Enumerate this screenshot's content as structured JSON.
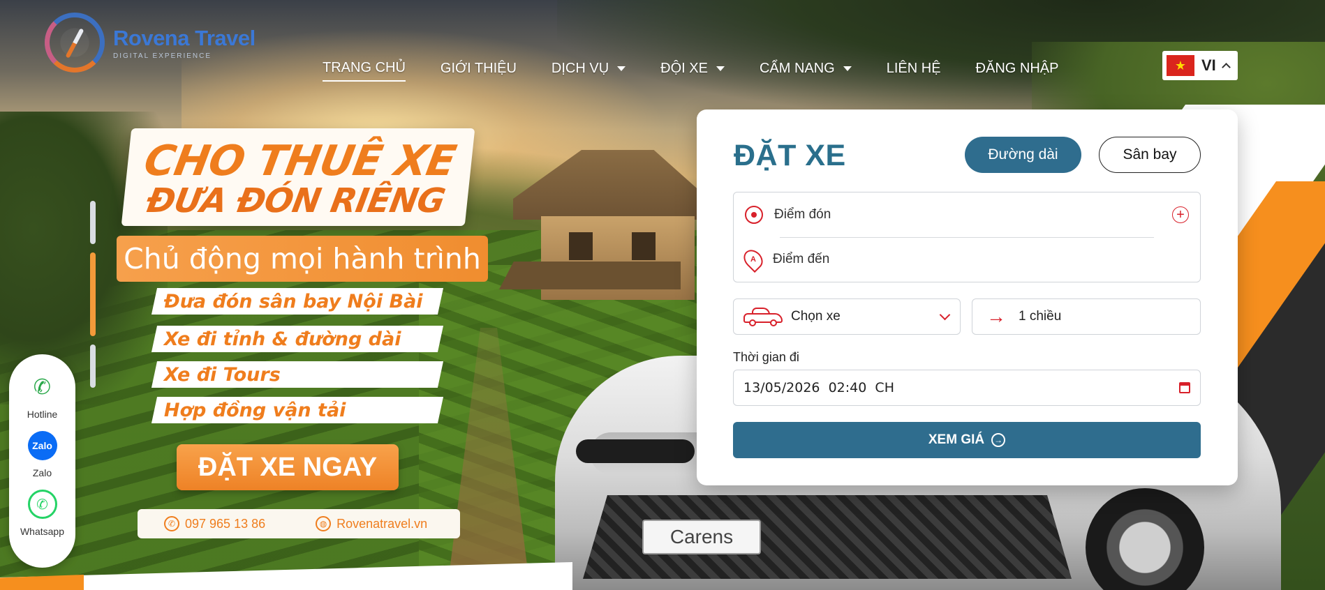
{
  "brand": {
    "name": "Rovena Travel",
    "tagline": "DIGITAL EXPERIENCE"
  },
  "nav": {
    "items": [
      {
        "label": "TRANG CHỦ",
        "active": true,
        "dropdown": false
      },
      {
        "label": "GIỚI THIỆU",
        "active": false,
        "dropdown": false
      },
      {
        "label": "DỊCH VỤ",
        "active": false,
        "dropdown": true
      },
      {
        "label": "ĐỘI XE",
        "active": false,
        "dropdown": true
      },
      {
        "label": "CẨM NANG",
        "active": false,
        "dropdown": true
      },
      {
        "label": "LIÊN HỆ",
        "active": false,
        "dropdown": false
      },
      {
        "label": "ĐĂNG NHẬP",
        "active": false,
        "dropdown": false
      }
    ]
  },
  "language": {
    "code": "VI",
    "flag_icon": "vietnam-flag-icon"
  },
  "promo": {
    "title_line1": "CHO THUÊ XE",
    "title_line2": "ĐƯA ĐÓN RIÊNG",
    "subtitle": "Chủ động mọi hành trình",
    "services": [
      "Đưa đón sân bay Nội Bài",
      "Xe đi tỉnh & đường dài",
      "Xe đi Tours",
      "Hợp đồng vận tải"
    ],
    "cta": "ĐẶT XE NGAY",
    "phone": "097 965 13 86",
    "website": "Rovenatravel.vn"
  },
  "float_contact": [
    {
      "label": "Hotline",
      "icon": "phone-icon"
    },
    {
      "label": "Zalo",
      "icon": "zalo-icon",
      "icon_text": "Zalo"
    },
    {
      "label": "Whatsapp",
      "icon": "whatsapp-icon"
    }
  ],
  "booking": {
    "title": "ĐẶT XE",
    "tabs": {
      "long_distance": "Đường dài",
      "airport": "Sân bay"
    },
    "pickup_placeholder": "Điểm đón",
    "dropoff_placeholder": "Điểm đến",
    "pin_a_letter": "A",
    "add_stop_symbol": "+",
    "car_select": "Chọn xe",
    "trip_type": "1 chiều",
    "trip_arrow": "→",
    "time_label": "Thời gian đi",
    "time_value": "13/05/2026  02:40  CH",
    "submit": "XEM GIÁ"
  },
  "car_plate": "Carens",
  "colors": {
    "accent_orange": "#ef7d1d",
    "primary_teal": "#2f6d8e",
    "icon_red": "#d8202a",
    "brand_blue": "#3b78d6"
  }
}
